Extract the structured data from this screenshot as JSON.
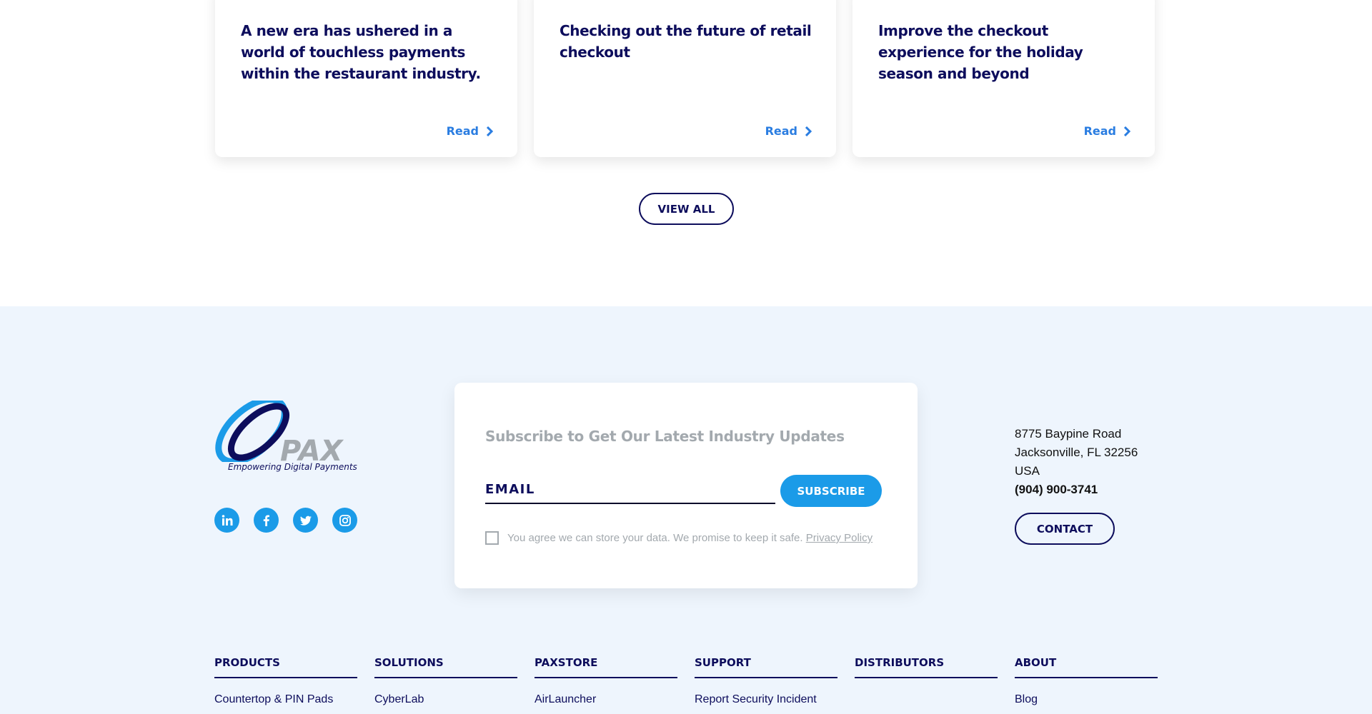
{
  "blog": {
    "cards": [
      {
        "title": "A new era has ushered in a world of touchless payments within the restaurant industry.",
        "link_label": "Read"
      },
      {
        "title": "Checking out the future of retail checkout",
        "link_label": "Read"
      },
      {
        "title": "Improve the checkout experience for the holiday season and beyond",
        "link_label": "Read"
      }
    ],
    "view_all_label": "VIEW ALL"
  },
  "footer": {
    "logo": {
      "brand": "PAX",
      "tagline": "Empowering Digital Payments"
    },
    "socials": [
      {
        "name": "linkedin",
        "icon": "linkedin-icon"
      },
      {
        "name": "facebook",
        "icon": "facebook-icon"
      },
      {
        "name": "twitter",
        "icon": "twitter-icon"
      },
      {
        "name": "instagram",
        "icon": "instagram-icon"
      }
    ],
    "subscribe": {
      "title": "Subscribe to Get Our Latest Industry Updates",
      "email_placeholder": "EMAIL",
      "email_value": "",
      "button_label": "SUBSCRIBE",
      "consent_text": "You agree we can store your data. We promise to keep it safe.",
      "privacy_link": "Privacy Policy"
    },
    "address": {
      "line1": "8775 Baypine Road",
      "line2": "Jacksonville, FL 32256",
      "line3": "USA",
      "phone": "(904) 900-3741"
    },
    "contact_label": "CONTACT",
    "nav": [
      {
        "heading": "PRODUCTS",
        "links": [
          "Countertop & PIN Pads"
        ]
      },
      {
        "heading": "SOLUTIONS",
        "links": [
          "CyberLab"
        ]
      },
      {
        "heading": "PAXSTORE",
        "links": [
          "AirLauncher"
        ]
      },
      {
        "heading": "SUPPORT",
        "links": [
          "Report Security Incident"
        ]
      },
      {
        "heading": "DISTRIBUTORS",
        "links": []
      },
      {
        "heading": "ABOUT",
        "links": [
          "Blog"
        ]
      }
    ]
  },
  "colors": {
    "navy": "#0d0d5c",
    "accent_blue": "#1b9be8",
    "link_blue": "#2a7de1",
    "footer_bg": "#eef5fd",
    "muted_gray": "#a3a9ae"
  }
}
